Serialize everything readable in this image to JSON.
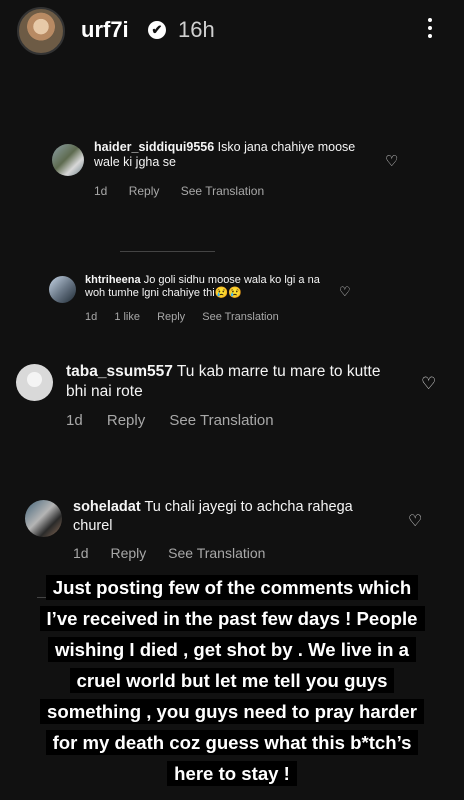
{
  "story": {
    "username": "urf7i",
    "verified_mark": "✔",
    "time": "16h",
    "more_icon": "more-vertical-icon"
  },
  "comments": [
    {
      "username": "haider_siddiqui9556",
      "text": "Isko jana chahiye moose wale ki jgha se",
      "time": "1d",
      "likes": "",
      "reply": "Reply",
      "translation": "See Translation"
    },
    {
      "username": "khtriheena",
      "text": "Jo goli sidhu moose wala ko lgi a na woh tumhe lgni chahiye thi😢😢",
      "time": "1d",
      "likes": "1 like",
      "reply": "Reply",
      "translation": "See Translation"
    },
    {
      "username": "taba_ssum557",
      "text": "Tu kab marre tu mare to kutte bhi nai rote",
      "time": "1d",
      "likes": "",
      "reply": "Reply",
      "translation": "See Translation"
    },
    {
      "username": "soheladat",
      "text": "Tu chali jayegi to achcha rahega churel",
      "time": "1d",
      "likes": "",
      "reply": "Reply",
      "translation": "See Translation"
    }
  ],
  "overlay_text": "Just posting few of the comments which I’ve received in the past few days ! People wishing I died , get shot by . We live in a cruel world but let me tell you guys something , you guys need to pray harder for my death coz guess what this b*tch’s here to stay !",
  "icons": {
    "heart": "♡"
  },
  "colors": {
    "background": "#111111",
    "muted_text": "#a8a8a8",
    "overlay_bg": "#000000"
  }
}
